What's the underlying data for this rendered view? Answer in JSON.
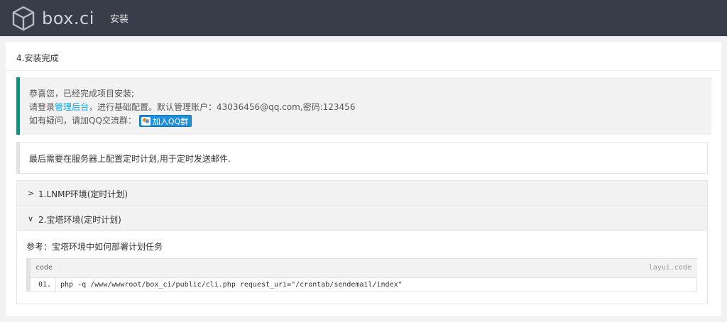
{
  "header": {
    "logo_text": "box.ci",
    "nav_item": "安装"
  },
  "card": {
    "title": "4.安装完成"
  },
  "notice": {
    "line1": "恭喜您，已经完成项目安装;",
    "line2_prefix": "请登录",
    "admin_link": "管理后台",
    "line2_suffix": "，进行基础配置。默认管理账户：43036456@qq.com,密码:123456",
    "line3": "如有疑问，请加QQ交流群：",
    "qq_button": "加入QQ群"
  },
  "cron_note": "最后需要在服务器上配置定时计划,用于定时发送邮件.",
  "collapse": {
    "items": [
      {
        "label": "1.LNMP环境(定时计划)",
        "arrow": ">"
      },
      {
        "label": "2.宝塔环境(定时计划)",
        "arrow": "∨"
      }
    ],
    "body_ref": "参考：宝塔环境中如何部署计划任务",
    "code": {
      "title": "code",
      "brand": "layui.code",
      "line_no": "01.",
      "line": "php -q /www/wwwroot/box_ci/public/cli.php request_uri=\"/crontab/sendemail/index\""
    }
  },
  "colors": {
    "header_bg": "#393d49",
    "accent_green": "#009688",
    "link_blue": "#01aaed",
    "qq_button_bg": "#1f8fd9"
  }
}
